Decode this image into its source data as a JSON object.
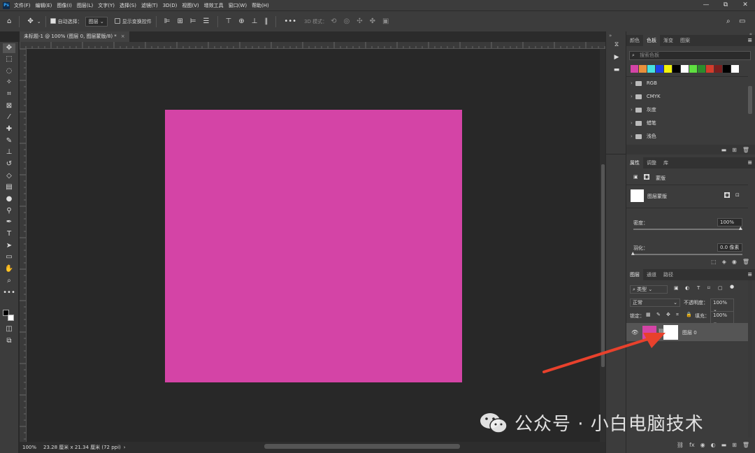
{
  "app": {
    "logo": "Ps"
  },
  "menu": [
    "文件(F)",
    "编辑(E)",
    "图像(I)",
    "图层(L)",
    "文字(Y)",
    "选择(S)",
    "滤镜(T)",
    "3D(D)",
    "视图(V)",
    "增效工具",
    "窗口(W)",
    "帮助(H)"
  ],
  "window_controls": {
    "min": "—",
    "max": "⧉",
    "close": "✕"
  },
  "options": {
    "auto_select_label": "自动选择：",
    "auto_select_value": "图层",
    "show_transform_label": "显示变换控件",
    "mode_3d": "3D 模式："
  },
  "document": {
    "tab_title": "未标题-1 @ 100% (图层 0, 图层蒙版/8) *",
    "close": "×",
    "artboard_color": "#d444a6"
  },
  "status": {
    "zoom": "100%",
    "size": "23.28 厘米 x 21.34 厘米 (72 ppi)",
    "arrow": "›"
  },
  "swatches_panel": {
    "tabs": [
      "颜色",
      "色板",
      "渐变",
      "图案"
    ],
    "active_tab": "色板",
    "search_placeholder": "搜索色板",
    "colors": [
      "#d444a6",
      "#e8903c",
      "#46e0e0",
      "#1d3fe6",
      "#f2f20a",
      "#000000",
      "#ffffff",
      "#5fe040",
      "#2c8c2c",
      "#d43c2c",
      "#7a1e1e",
      "#000000",
      "#ffffff"
    ],
    "groups": [
      "RGB",
      "CMYK",
      "灰度",
      "蜡笔",
      "浅色"
    ]
  },
  "properties_panel": {
    "tabs": [
      "属性",
      "调整",
      "库"
    ],
    "active_tab": "属性",
    "section_label": "蒙版",
    "mask_label": "图层蒙版",
    "density_label": "密度：",
    "density_value": "100%",
    "feather_label": "羽化：",
    "feather_value": "0.0 像素"
  },
  "layers_panel": {
    "tabs": [
      "图层",
      "通道",
      "路径"
    ],
    "active_tab": "图层",
    "filter_kind": "类型",
    "blend_mode": "正常",
    "opacity_label": "不透明度：",
    "opacity_value": "100%",
    "lock_label": "锁定：",
    "fill_label": "填充：",
    "fill_value": "100%",
    "layer": {
      "name": "图层 0",
      "thumb_color": "#d444a6",
      "mask_color": "#ffffff"
    }
  },
  "watermark": "公众号 · 小白电脑技术",
  "annotation_arrow_color": "#e8412c"
}
